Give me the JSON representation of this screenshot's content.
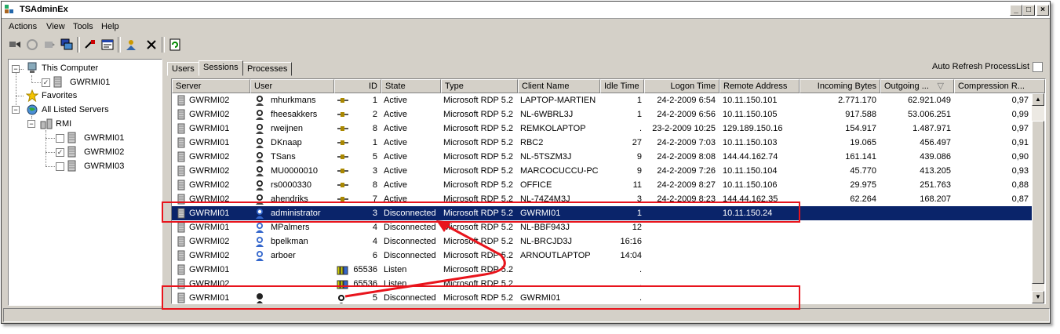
{
  "window": {
    "title": "TSAdminEx"
  },
  "menu": [
    "Actions",
    "View",
    "Tools",
    "Help"
  ],
  "toolbar": {
    "icons": [
      "connect-icon",
      "disconnect-icon",
      "send-message-icon",
      "remote-control-icon",
      "reset-icon",
      "status-icon",
      "logoff-icon",
      "end-process-icon",
      "refresh-icon"
    ]
  },
  "tree": {
    "this_computer": "This Computer",
    "this_computer_child": "GWRMI01",
    "favorites": "Favorites",
    "all_listed": "All Listed Servers",
    "rmi": "RMI",
    "servers": [
      {
        "name": "GWRMI01",
        "checked": false
      },
      {
        "name": "GWRMI02",
        "checked": true
      },
      {
        "name": "GWRMI03",
        "checked": false
      }
    ]
  },
  "tabs": [
    "Users",
    "Sessions",
    "Processes"
  ],
  "active_tab": "Sessions",
  "auto_refresh_label": "Auto Refresh ProcessList",
  "columns": [
    "Server",
    "User",
    "ID",
    "State",
    "Type",
    "Client Name",
    "Idle Time",
    "Logon Time",
    "Remote Address",
    "Incoming Bytes",
    "Outgoing ...",
    "Compression R..."
  ],
  "colors": {
    "selection": "#0a246a",
    "annotation": "#e8141c"
  },
  "rows": [
    {
      "server": "GWRMI02",
      "user": "mhurkmans",
      "icon": "user",
      "id": "1",
      "state": "Active",
      "type": "Microsoft RDP 5.2",
      "client": "LAPTOP-MARTIEN",
      "idle": "1",
      "logon": "24-2-2009 6:54",
      "remote": "10.11.150.101",
      "in": "2.771.170",
      "out": "62.921.049",
      "comp": "0,97"
    },
    {
      "server": "GWRMI02",
      "user": "fheesakkers",
      "icon": "user",
      "id": "2",
      "state": "Active",
      "type": "Microsoft RDP 5.2",
      "client": "NL-6WBRL3J",
      "idle": "1",
      "logon": "24-2-2009 6:56",
      "remote": "10.11.150.105",
      "in": "917.588",
      "out": "53.006.251",
      "comp": "0,99"
    },
    {
      "server": "GWRMI01",
      "user": "rweijnen",
      "icon": "user",
      "id": "8",
      "state": "Active",
      "type": "Microsoft RDP 5.2",
      "client": "REMKOLAPTOP",
      "idle": ".",
      "logon": "23-2-2009 10:25",
      "remote": "129.189.150.16",
      "in": "154.917",
      "out": "1.487.971",
      "comp": "0,97"
    },
    {
      "server": "GWRMI01",
      "user": "DKnaap",
      "icon": "user",
      "id": "1",
      "state": "Active",
      "type": "Microsoft RDP 5.2",
      "client": "RBC2",
      "idle": "27",
      "logon": "24-2-2009 7:03",
      "remote": "10.11.150.103",
      "in": "19.065",
      "out": "456.497",
      "comp": "0,91"
    },
    {
      "server": "GWRMI02",
      "user": "TSans",
      "icon": "user",
      "id": "5",
      "state": "Active",
      "type": "Microsoft RDP 5.2",
      "client": "NL-5TSZM3J",
      "idle": "9",
      "logon": "24-2-2009 8:08",
      "remote": "144.44.162.74",
      "in": "161.141",
      "out": "439.086",
      "comp": "0,90"
    },
    {
      "server": "GWRMI02",
      "user": "MU0000010",
      "icon": "user",
      "id": "3",
      "state": "Active",
      "type": "Microsoft RDP 5.2",
      "client": "MARCOCUCCU-PC",
      "idle": "9",
      "logon": "24-2-2009 7:26",
      "remote": "10.11.150.104",
      "in": "45.770",
      "out": "413.205",
      "comp": "0,93"
    },
    {
      "server": "GWRMI02",
      "user": "rs0000330",
      "icon": "user",
      "id": "8",
      "state": "Active",
      "type": "Microsoft RDP 5.2",
      "client": "OFFICE",
      "idle": "11",
      "logon": "24-2-2009 8:27",
      "remote": "10.11.150.106",
      "in": "29.975",
      "out": "251.763",
      "comp": "0,88"
    },
    {
      "server": "GWRMI02",
      "user": "ahendriks",
      "icon": "user",
      "id": "7",
      "state": "Active",
      "type": "Microsoft RDP 5.2",
      "client": "NL-74Z4M3J",
      "idle": "3",
      "logon": "24-2-2009 8:23",
      "remote": "144.44.162.35",
      "in": "62.264",
      "out": "168.207",
      "comp": "0,87"
    },
    {
      "server": "GWRMI01",
      "user": "administrator",
      "icon": "disc",
      "id": "3",
      "state": "Disconnected",
      "type": "Microsoft RDP 5.2",
      "client": "GWRMI01",
      "idle": "1",
      "logon": "",
      "remote": "10.11.150.24",
      "in": "",
      "out": "",
      "comp": "",
      "selected": true
    },
    {
      "server": "GWRMI01",
      "user": "MPalmers",
      "icon": "disc",
      "id": "4",
      "state": "Disconnected",
      "type": "Microsoft RDP 5.2",
      "client": "NL-BBF943J",
      "idle": "12",
      "logon": "",
      "remote": "",
      "in": "",
      "out": "",
      "comp": ""
    },
    {
      "server": "GWRMI02",
      "user": "bpelkman",
      "icon": "disc",
      "id": "4",
      "state": "Disconnected",
      "type": "Microsoft RDP 5.2",
      "client": "NL-BRCJD3J",
      "idle": "16:16",
      "logon": "",
      "remote": "",
      "in": "",
      "out": "",
      "comp": ""
    },
    {
      "server": "GWRMI02",
      "user": "arboer",
      "icon": "disc",
      "id": "6",
      "state": "Disconnected",
      "type": "Microsoft RDP 5.2",
      "client": "ARNOUTLAPTOP",
      "idle": "14:04",
      "logon": "",
      "remote": "",
      "in": "",
      "out": "",
      "comp": ""
    },
    {
      "server": "GWRMI01",
      "user": "",
      "icon": "listen",
      "id": "65536",
      "state": "Listen",
      "type": "Microsoft RDP 5.2",
      "client": "",
      "idle": ".",
      "logon": "",
      "remote": "",
      "in": "",
      "out": "",
      "comp": ""
    },
    {
      "server": "GWRMI02",
      "user": "",
      "icon": "listen",
      "id": "65536",
      "state": "Listen",
      "type": "Microsoft RDP 5.2",
      "client": "",
      "idle": ".",
      "logon": "",
      "remote": "",
      "in": "",
      "out": "",
      "comp": ""
    },
    {
      "server": "GWRMI01",
      "user": "",
      "icon": "console",
      "id": "5",
      "state": "Disconnected",
      "type": "Microsoft RDP 5.2",
      "client": "GWRMI01",
      "idle": ".",
      "logon": "",
      "remote": "",
      "in": "",
      "out": "",
      "comp": ""
    }
  ]
}
